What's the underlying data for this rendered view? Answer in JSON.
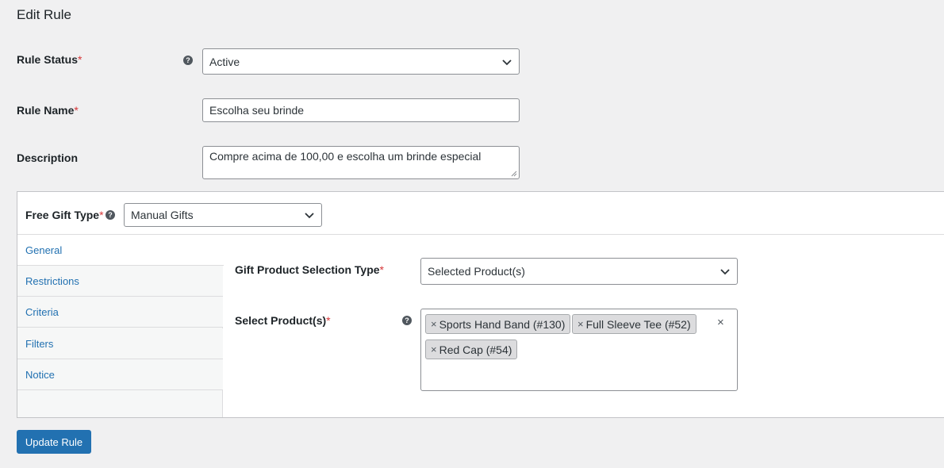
{
  "page": {
    "title": "Edit Rule"
  },
  "form": {
    "rule_status": {
      "label": "Rule Status",
      "required": "*",
      "help": "?",
      "value": "Active"
    },
    "rule_name": {
      "label": "Rule Name",
      "required": "*",
      "value": "Escolha seu brinde"
    },
    "description": {
      "label": "Description",
      "value": "Compre acima de 100,00 e escolha um brinde especial"
    }
  },
  "panel": {
    "gift_type": {
      "label": "Free Gift Type",
      "required": "*",
      "help": "?",
      "value": "Manual Gifts"
    },
    "tabs": [
      {
        "label": "General"
      },
      {
        "label": "Restrictions"
      },
      {
        "label": "Criteria"
      },
      {
        "label": "Filters"
      },
      {
        "label": "Notice"
      }
    ],
    "selection_type": {
      "label": "Gift Product Selection Type",
      "required": "*",
      "value": "Selected Product(s)"
    },
    "select_products": {
      "label": "Select Product(s)",
      "required": "*",
      "help": "?",
      "chips": [
        {
          "label": "Sports Hand Band (#130)",
          "remove": "×"
        },
        {
          "label": "Full Sleeve Tee (#52)",
          "remove": "×"
        },
        {
          "label": "Red Cap (#54)",
          "remove": "×"
        }
      ],
      "clear": "×"
    }
  },
  "actions": {
    "update_label": "Update Rule"
  },
  "colors": {
    "primary": "#2271b1",
    "required": "#d63638",
    "background": "#f0f0f1"
  }
}
